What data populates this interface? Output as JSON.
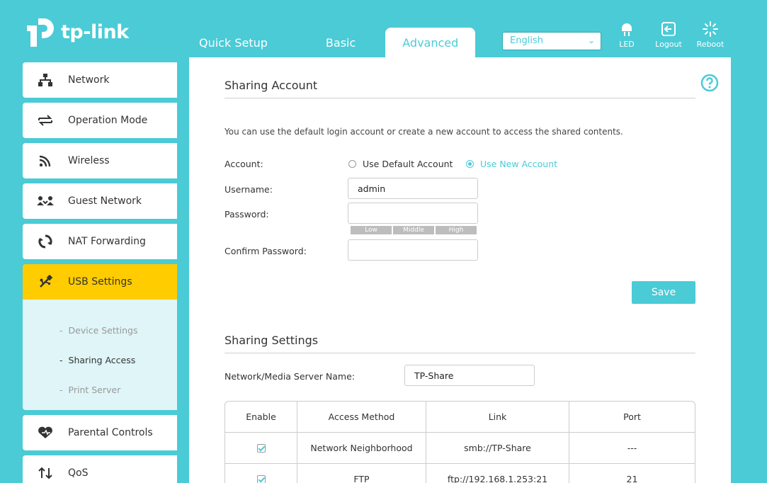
{
  "brand": {
    "name": "tp-link"
  },
  "tabs": [
    {
      "label": "Quick Setup"
    },
    {
      "label": "Basic"
    },
    {
      "label": "Advanced"
    }
  ],
  "language": {
    "selected": "English"
  },
  "header_buttons": {
    "led": "LED",
    "logout": "Logout",
    "reboot": "Reboot"
  },
  "sidebar": {
    "items": [
      {
        "label": "Network",
        "icon": "network-icon"
      },
      {
        "label": "Operation Mode",
        "icon": "operation-mode-icon"
      },
      {
        "label": "Wireless",
        "icon": "wireless-icon"
      },
      {
        "label": "Guest Network",
        "icon": "guest-network-icon"
      },
      {
        "label": "NAT Forwarding",
        "icon": "nat-forwarding-icon"
      },
      {
        "label": "USB Settings",
        "icon": "usb-icon"
      },
      {
        "label": "Parental Controls",
        "icon": "parental-controls-icon"
      },
      {
        "label": "QoS",
        "icon": "qos-icon"
      }
    ],
    "usb_submenu": [
      {
        "label": "Device Settings"
      },
      {
        "label": "Sharing Access"
      },
      {
        "label": "Print Server"
      }
    ]
  },
  "sharing_account": {
    "title": "Sharing Account",
    "description": "You can use the default login account or create a new account to access the shared contents.",
    "account_label": "Account:",
    "option_default": "Use Default Account",
    "option_new": "Use New Account",
    "username_label": "Username:",
    "username_value": "admin",
    "password_label": "Password:",
    "password_value": "",
    "strength": {
      "low": "Low",
      "middle": "Middle",
      "high": "High"
    },
    "confirm_label": "Confirm Password:",
    "confirm_value": "",
    "save_label": "Save"
  },
  "sharing_settings": {
    "title": "Sharing Settings",
    "server_name_label": "Network/Media Server Name:",
    "server_name_value": "TP-Share",
    "table": {
      "headers": {
        "enable": "Enable",
        "method": "Access Method",
        "link": "Link",
        "port": "Port"
      },
      "rows": [
        {
          "method": "Network Neighborhood",
          "link": "smb://TP-Share",
          "port": "---"
        },
        {
          "method": "FTP",
          "link": "ftp://192.168.1.253:21",
          "port": "21"
        }
      ]
    }
  },
  "colors": {
    "accent": "#4acbd6",
    "active_menu": "#ffcc00"
  }
}
